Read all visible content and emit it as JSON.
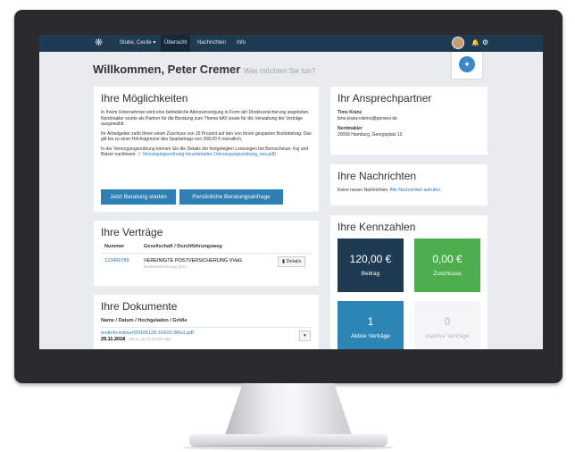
{
  "navbar": {
    "user_menu": "Stube, Cecile ▾",
    "tabs": [
      "Übersicht",
      "Nachrichten",
      "Info"
    ]
  },
  "welcome": {
    "title": "Willkommen, Peter Cremer",
    "subtitle": "Was möchten Sie tun?"
  },
  "options": {
    "title": "Ihre Möglichkeiten",
    "p1": "In Ihrem Unternehmen wird eine betriebliche Altersversorgung in Form der Direktversicherung angeboten. Nordmakler wurde als Partner für die Beratung zum Thema bAV sowie für die Verwaltung der Verträge ausgewählt.",
    "p2": "Ihr Arbeitgeber zahlt Ihnen einen Zuschuss von 15 Prozent auf den von Ihnen gesparten Bruttobetrag. Das gilt bis zu einer Höchstgrenze des Sparbetrags von 268,00 € monatlich.",
    "p3_text": "In der Versorgungsordnung können Sie die Details der festgelegten Leistungen bei Bornscheuer, Koj und Balzer nachlesen:",
    "p3_link": "Versorgungsordnung herunterladen (Versorgungsordnung_neu.pdf)",
    "btn_start": "Jetzt Beratung starten",
    "btn_request": "Persönliche Beratungsanfrage"
  },
  "contact": {
    "title": "Ihr Ansprechpartner",
    "name": "Timo Kranz",
    "email": "timo.kranz+demo@penseo.de",
    "company": "Nordmakler",
    "address": "20099 Hamburg, Georgsplatz 10"
  },
  "messages": {
    "title": "Ihre Nachrichten",
    "text": "Keine neuen Nachrichten.",
    "link": "Alle Nachrichten aufrufen."
  },
  "kpis": {
    "title": "Ihre Kennzahlen",
    "items": [
      {
        "value": "120,00 €",
        "label": "Beitrag"
      },
      {
        "value": "0,00 €",
        "label": "Zuschüsse"
      },
      {
        "value": "1",
        "label": "Aktive Verträge"
      },
      {
        "value": "0",
        "label": "Inaktive Verträge"
      }
    ]
  },
  "contracts": {
    "title": "Ihre Verträge",
    "col_number": "Nummer",
    "col_company": "Gesellschaft / Durchführungsweg",
    "row": {
      "number": "123456789",
      "company": "VEREINIGTE POSTVERSICHERUNG VVaG",
      "type": "Direktversicherung (DV)",
      "details": "Details"
    }
  },
  "documents": {
    "title": "Ihre Dokumente",
    "header": "Name / Datum / Hochgeladen / Größe",
    "file": "erstinfo-entwurf20181129-31423-36fa1.pdf",
    "date": "29.11.2018",
    "meta": "29.11.18 10:03 (60 KB)"
  },
  "colors": {
    "navbar": "#1f3b52",
    "accent": "#2d7fb4",
    "green": "#4cae4c"
  }
}
